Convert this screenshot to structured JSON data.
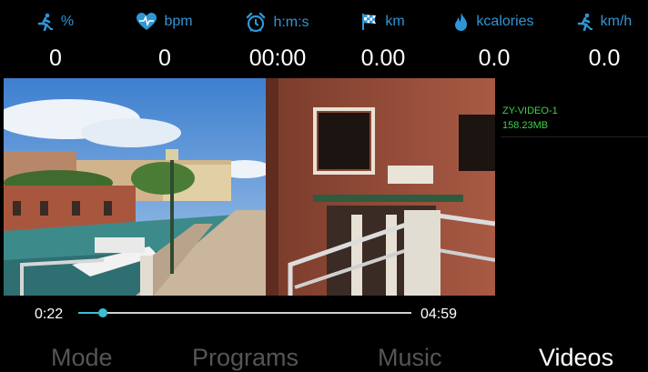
{
  "metrics": [
    {
      "icon": "runner-icon",
      "unit": "%",
      "value": "0"
    },
    {
      "icon": "heart-rate-icon",
      "unit": "bpm",
      "value": "0"
    },
    {
      "icon": "alarm-clock-icon",
      "unit": "h:m:s",
      "value": "00:00"
    },
    {
      "icon": "checkered-flag-icon",
      "unit": "km",
      "value": "0.00"
    },
    {
      "icon": "flame-icon",
      "unit": "kcalories",
      "value": "0.0"
    },
    {
      "icon": "runner-speed-icon",
      "unit": "km/h",
      "value": "0.0"
    }
  ],
  "video_list": [
    {
      "name": "ZY-VIDEO-1",
      "size": "158.23MB"
    }
  ],
  "player": {
    "current_time": "0:22",
    "total_time": "04:59",
    "progress": 0.073
  },
  "tabs": [
    {
      "label": "Mode",
      "active": false
    },
    {
      "label": "Programs",
      "active": false
    },
    {
      "label": "Music",
      "active": false
    },
    {
      "label": "Videos",
      "active": true
    }
  ],
  "colors": {
    "accent_blue": "#2f96d6",
    "list_green": "#3fd04a",
    "progress": "#3bbfd0",
    "tab_inactive": "#555555",
    "tab_active": "#ffffff"
  }
}
